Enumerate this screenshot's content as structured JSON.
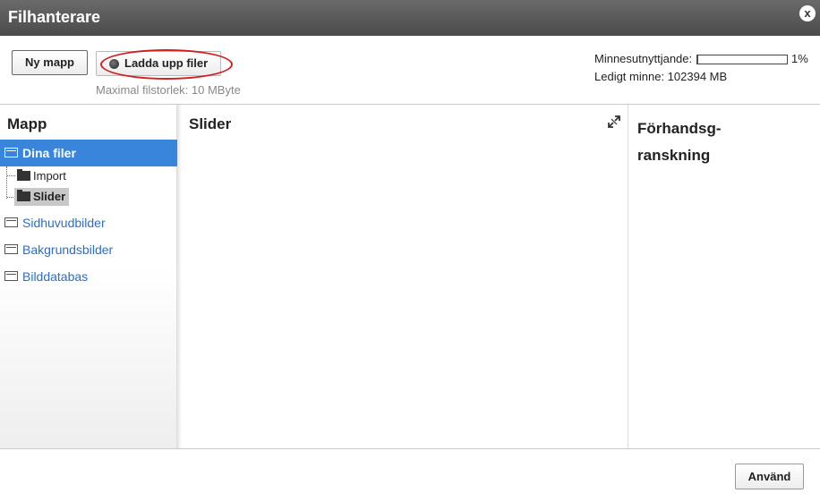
{
  "window": {
    "title": "Filhanterare",
    "close_label": "x"
  },
  "toolbar": {
    "new_folder_label": "Ny mapp",
    "upload_label": "Ladda upp filer",
    "max_size_text": "Maximal filstorlek: 10 MByte"
  },
  "memory": {
    "usage_label": "Minnesutnyttjande:",
    "usage_percent": "1%",
    "usage_fraction": 0.01,
    "free_text": "Ledigt minne: 102394 MB"
  },
  "sidebar": {
    "title": "Mapp",
    "folders": [
      {
        "label": "Dina filer",
        "active": true
      },
      {
        "label": "Sidhuvudbilder"
      },
      {
        "label": "Bakgrundsbilder"
      },
      {
        "label": "Bilddatabas"
      }
    ],
    "subfolders": [
      {
        "label": "Import"
      },
      {
        "label": "Slider",
        "selected": true
      }
    ]
  },
  "main": {
    "title": "Slider"
  },
  "preview": {
    "title": "Förhandsg-ranskning"
  },
  "footer": {
    "apply_label": "Använd"
  },
  "colors": {
    "accent": "#3a85dc",
    "link": "#2a6fc9",
    "highlight_ring": "#d02020",
    "titlebar": "#555555"
  },
  "icons": {
    "close": "close-icon",
    "folder": "folder-icon",
    "expand": "expand-icon"
  }
}
